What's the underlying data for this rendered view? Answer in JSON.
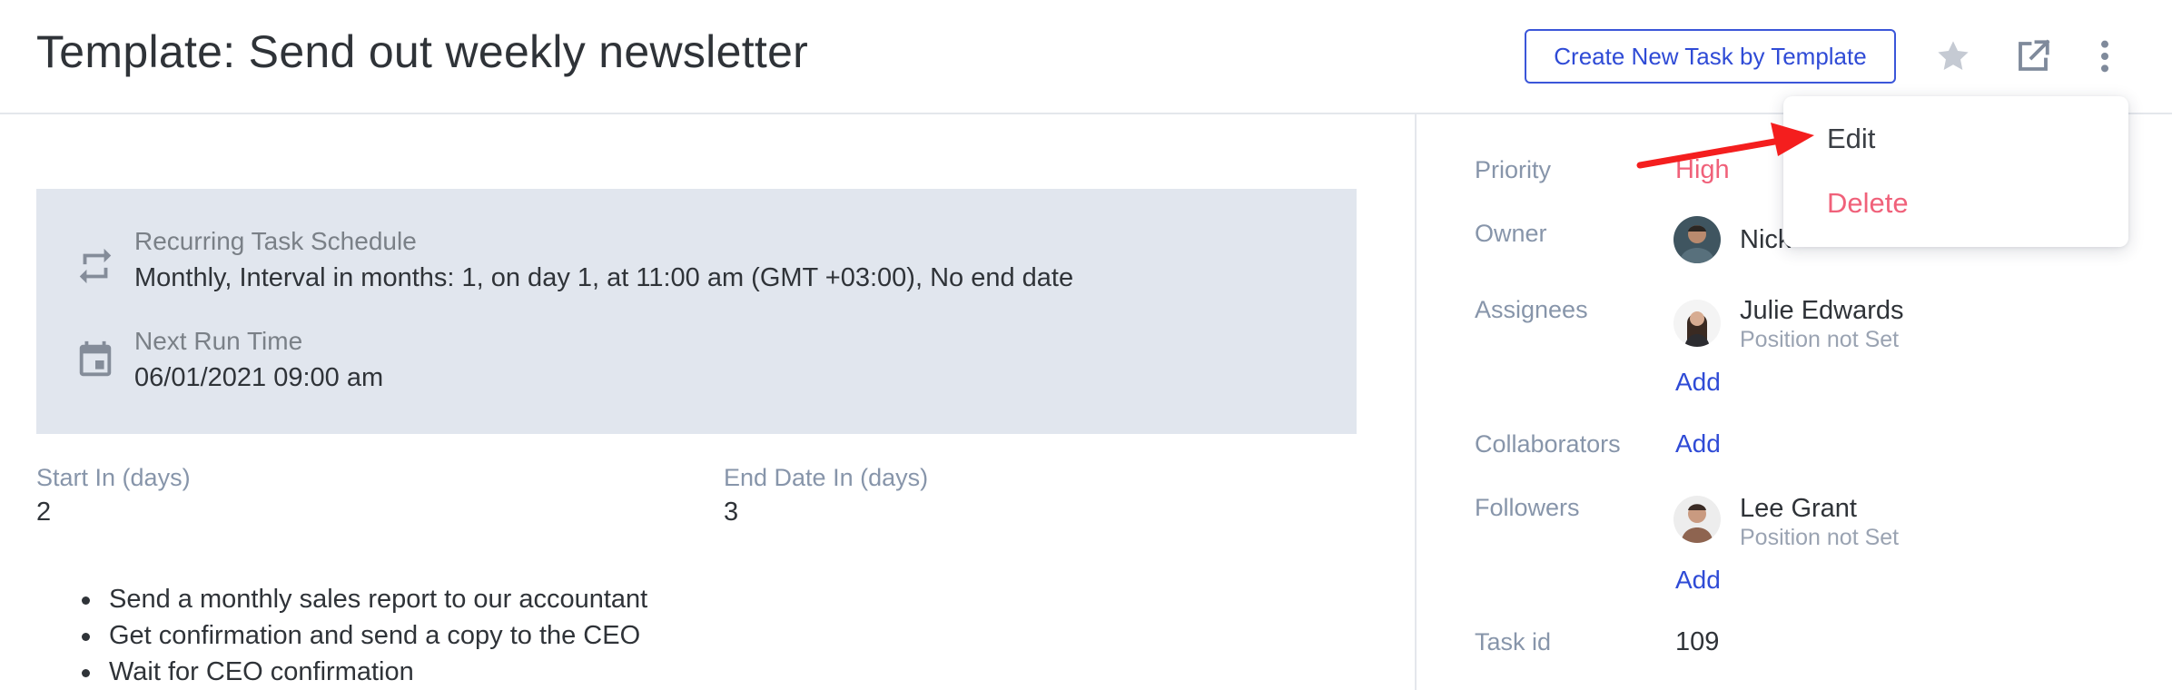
{
  "header": {
    "title": "Template: Send out weekly newsletter",
    "create_button": "Create New Task by Template",
    "icons": [
      "star-icon",
      "open-external-icon",
      "more-vertical-icon"
    ]
  },
  "schedule": {
    "recurring_label": "Recurring Task Schedule",
    "recurring_value": "Monthly, Interval in months: 1, on day 1, at 11:00 am (GMT +03:00), No end date",
    "next_run_label": "Next Run Time",
    "next_run_value": "06/01/2021 09:00 am"
  },
  "fields": {
    "start_label": "Start In (days)",
    "start_value": "2",
    "end_label": "End Date In (days)",
    "end_value": "3"
  },
  "description": {
    "items": [
      "Send a monthly sales report to our accountant",
      "Get confirmation and send a copy to the CEO",
      "Wait for CEO confirmation"
    ]
  },
  "sidebar": {
    "priority_label": "Priority",
    "priority_value": "High",
    "owner_label": "Owner",
    "owner_name": "Nick",
    "assignees_label": "Assignees",
    "assignee_name": "Julie Edwards",
    "assignee_position": "Position not Set",
    "collaborators_label": "Collaborators",
    "followers_label": "Followers",
    "follower_name": "Lee Grant",
    "follower_position": "Position not Set",
    "add_label": "Add",
    "task_id_label": "Task id",
    "task_id_value": "109"
  },
  "menu": {
    "edit": "Edit",
    "delete": "Delete"
  },
  "colors": {
    "accent": "#2f4bd6",
    "priority_high": "#f0617a",
    "delete": "#f0617a",
    "schedule_bg": "#e1e6ee",
    "annotation_arrow": "#f41e1e"
  }
}
